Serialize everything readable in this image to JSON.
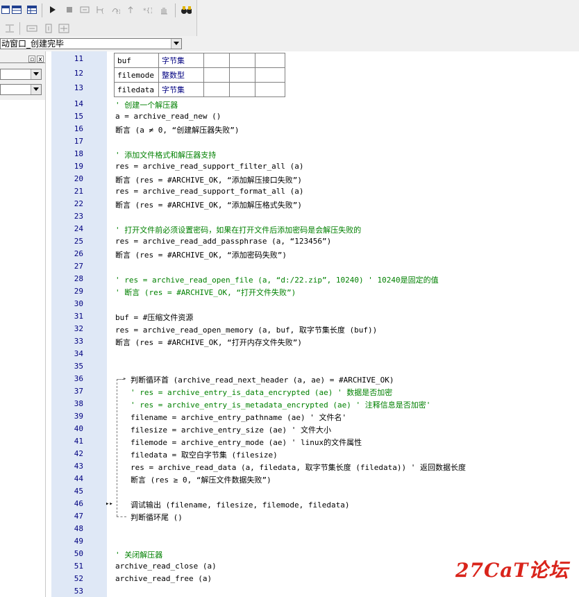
{
  "toolbar": {
    "combo_text": "动窗口_创建完毕",
    "icons": [
      "window-icon",
      "grid-icon",
      "table-icon",
      "run-icon",
      "stop-icon",
      "step-icon",
      "step-into-icon",
      "step-over-icon",
      "step-out-icon",
      "breakpoint-icon",
      "hand-icon",
      "binoculars-icon",
      "align-icon",
      "hspace-icon",
      "vspace-icon",
      "center-icon"
    ]
  },
  "left_panel": {
    "close_label": "x",
    "pin_label": "▫"
  },
  "table": {
    "rows": [
      {
        "line": "11",
        "name": "buf",
        "type": "字节集"
      },
      {
        "line": "12",
        "name": "filemode",
        "type": "整数型"
      },
      {
        "line": "13",
        "name": "filedata",
        "type": "字节集"
      }
    ]
  },
  "code_lines": [
    {
      "n": "14",
      "t": "' 创建一个解压器",
      "k": "cm",
      "x": 0
    },
    {
      "n": "15",
      "t": "a = archive_read_new ()",
      "k": "code",
      "x": 0
    },
    {
      "n": "16",
      "t": "断言 (a ≠ 0, “创建解压器失败”)",
      "k": "code",
      "x": 0
    },
    {
      "n": "17",
      "t": "",
      "k": "code",
      "x": 0
    },
    {
      "n": "18",
      "t": "' 添加文件格式和解压器支持",
      "k": "cm",
      "x": 0
    },
    {
      "n": "19",
      "t": "res = archive_read_support_filter_all (a)",
      "k": "code",
      "x": 0
    },
    {
      "n": "20",
      "t": "断言 (res = #ARCHIVE_OK, “添加解压接口失败”)",
      "k": "code",
      "x": 0
    },
    {
      "n": "21",
      "t": "res = archive_read_support_format_all (a)",
      "k": "code",
      "x": 0
    },
    {
      "n": "22",
      "t": "断言 (res = #ARCHIVE_OK, “添加解压格式失败”)",
      "k": "code",
      "x": 0
    },
    {
      "n": "23",
      "t": "",
      "k": "code",
      "x": 0
    },
    {
      "n": "24",
      "t": "' 打开文件前必须设置密码，如果在打开文件后添加密码是会解压失败的",
      "k": "cm",
      "x": 0
    },
    {
      "n": "25",
      "t": "res = archive_read_add_passphrase (a, “123456”)",
      "k": "code",
      "x": 0
    },
    {
      "n": "26",
      "t": "断言 (res = #ARCHIVE_OK, “添加密码失败”)",
      "k": "code",
      "x": 0
    },
    {
      "n": "27",
      "t": "",
      "k": "code",
      "x": 0
    },
    {
      "n": "28",
      "t": "' res = archive_read_open_file (a, “d:/22.zip”, 10240) ' 10240是固定的值",
      "k": "cm",
      "x": 0
    },
    {
      "n": "29",
      "t": "' 断言 (res = #ARCHIVE_OK, “打开文件失败”)",
      "k": "cm",
      "x": 0
    },
    {
      "n": "30",
      "t": "",
      "k": "code",
      "x": 0
    },
    {
      "n": "31",
      "t": "buf = #压缩文件资源",
      "k": "code",
      "x": 0
    },
    {
      "n": "32",
      "t": "res = archive_read_open_memory (a, buf, 取字节集长度 (buf))",
      "k": "code",
      "x": 0
    },
    {
      "n": "33",
      "t": "断言 (res = #ARCHIVE_OK, “打开内存文件失败”)",
      "k": "code",
      "x": 0
    },
    {
      "n": "34",
      "t": "",
      "k": "code",
      "x": 0
    },
    {
      "n": "35",
      "t": "",
      "k": "code",
      "x": 0
    },
    {
      "n": "36",
      "t": "判断循环首 (archive_read_next_header (a, ae) = #ARCHIVE_OK)",
      "k": "code",
      "x": 22
    },
    {
      "n": "37",
      "t": "' res = archive_entry_is_data_encrypted (ae) ' 数据是否加密",
      "k": "cm",
      "x": 22
    },
    {
      "n": "38",
      "t": "' res = archive_entry_is_metadata_encrypted (ae) ' 注释信息是否加密'",
      "k": "cm",
      "x": 22
    },
    {
      "n": "39",
      "t": "filename = archive_entry_pathname (ae) ' 文件名'",
      "k": "code",
      "x": 22
    },
    {
      "n": "40",
      "t": "filesize = archive_entry_size (ae) ' 文件大小",
      "k": "code",
      "x": 22
    },
    {
      "n": "41",
      "t": "filemode = archive_entry_mode (ae) ' linux的文件属性",
      "k": "code",
      "x": 22
    },
    {
      "n": "42",
      "t": "filedata = 取空白字节集 (filesize)",
      "k": "code",
      "x": 22
    },
    {
      "n": "43",
      "t": "res = archive_read_data (a, filedata, 取字节集长度 (filedata)) ' 返回数据长度",
      "k": "code",
      "x": 22
    },
    {
      "n": "44",
      "t": "断言 (res ≥ 0, “解压文件数据失败”)",
      "k": "code",
      "x": 22
    },
    {
      "n": "45",
      "t": "",
      "k": "code",
      "x": 22
    },
    {
      "n": "46",
      "t": "调试输出 (filename, filesize, filemode, filedata)",
      "k": "code",
      "x": 22
    },
    {
      "n": "47",
      "t": "判断循环尾 ()",
      "k": "code",
      "x": 22
    },
    {
      "n": "48",
      "t": "",
      "k": "code",
      "x": 0
    },
    {
      "n": "49",
      "t": "",
      "k": "code",
      "x": 0
    },
    {
      "n": "50",
      "t": "' 关闭解压器",
      "k": "cm",
      "x": 0
    },
    {
      "n": "51",
      "t": "archive_read_close (a)",
      "k": "code",
      "x": 0
    },
    {
      "n": "52",
      "t": "archive_read_free (a)",
      "k": "code",
      "x": 0
    },
    {
      "n": "53",
      "t": "",
      "k": "code",
      "x": 0
    }
  ],
  "watermark": "27CaT论坛",
  "colors": {
    "gutter": "#dfe8f6",
    "line_number": "#000080",
    "comment": "#008000",
    "watermark": "#d9241b"
  }
}
